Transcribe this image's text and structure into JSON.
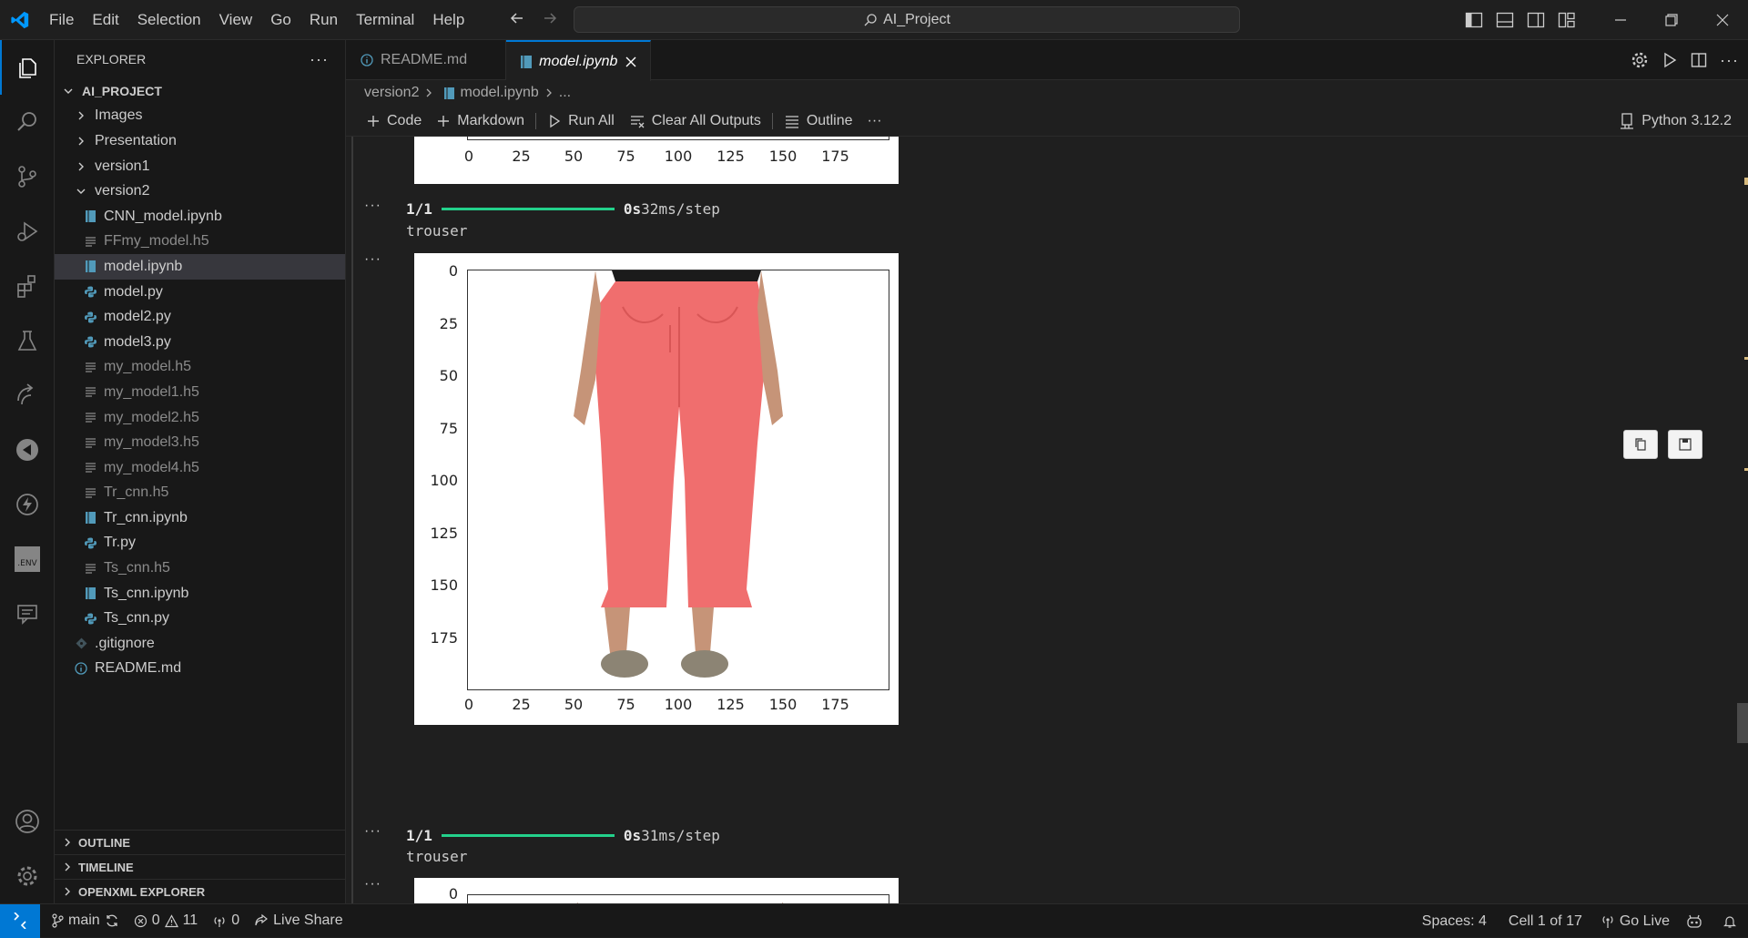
{
  "titlebar": {
    "menu": [
      "File",
      "Edit",
      "Selection",
      "View",
      "Go",
      "Run",
      "Terminal",
      "Help"
    ],
    "search_text": "AI_Project"
  },
  "sidebar": {
    "title": "EXPLORER",
    "project": "AI_PROJECT",
    "items": [
      {
        "label": "Images",
        "type": "folder",
        "state": "closed",
        "depth": 1
      },
      {
        "label": "Presentation",
        "type": "folder",
        "state": "closed",
        "depth": 1
      },
      {
        "label": "version1",
        "type": "folder",
        "state": "closed",
        "depth": 1
      },
      {
        "label": "version2",
        "type": "folder",
        "state": "open",
        "depth": 1
      },
      {
        "label": "CNN_model.ipynb",
        "type": "notebook",
        "depth": 2
      },
      {
        "label": "FFmy_model.h5",
        "type": "h5",
        "depth": 2
      },
      {
        "label": "model.ipynb",
        "type": "notebook",
        "depth": 2,
        "selected": true
      },
      {
        "label": "model.py",
        "type": "python",
        "depth": 2
      },
      {
        "label": "model2.py",
        "type": "python",
        "depth": 2
      },
      {
        "label": "model3.py",
        "type": "python",
        "depth": 2
      },
      {
        "label": "my_model.h5",
        "type": "h5",
        "depth": 2
      },
      {
        "label": "my_model1.h5",
        "type": "h5",
        "depth": 2
      },
      {
        "label": "my_model2.h5",
        "type": "h5",
        "depth": 2
      },
      {
        "label": "my_model3.h5",
        "type": "h5",
        "depth": 2
      },
      {
        "label": "my_model4.h5",
        "type": "h5",
        "depth": 2
      },
      {
        "label": "Tr_cnn.h5",
        "type": "h5",
        "depth": 2
      },
      {
        "label": "Tr_cnn.ipynb",
        "type": "notebook",
        "depth": 2
      },
      {
        "label": "Tr.py",
        "type": "python",
        "depth": 2
      },
      {
        "label": "Ts_cnn.h5",
        "type": "h5",
        "depth": 2
      },
      {
        "label": "Ts_cnn.ipynb",
        "type": "notebook",
        "depth": 2
      },
      {
        "label": "Ts_cnn.py",
        "type": "python",
        "depth": 2
      },
      {
        "label": ".gitignore",
        "type": "git",
        "depth": 1
      },
      {
        "label": "README.md",
        "type": "info",
        "depth": 1
      }
    ],
    "panels": [
      "OUTLINE",
      "TIMELINE",
      "OPENXML EXPLORER"
    ]
  },
  "tabs": [
    {
      "label": "README.md",
      "active": false
    },
    {
      "label": "model.ipynb",
      "active": true
    }
  ],
  "breadcrumb": [
    "version2",
    "model.ipynb",
    "..."
  ],
  "toolbar": {
    "code": "Code",
    "markdown": "Markdown",
    "run_all": "Run All",
    "clear": "Clear All Outputs",
    "outline": "Outline",
    "more": "···",
    "kernel": "Python 3.12.2"
  },
  "outputs": {
    "dots": "···",
    "x_ticks": [
      "0",
      "25",
      "50",
      "75",
      "100",
      "125",
      "150",
      "175"
    ],
    "y_ticks": [
      "0",
      "25",
      "50",
      "75",
      "100",
      "125",
      "150",
      "175"
    ],
    "y_ticks_partial": [
      "0"
    ],
    "progress": [
      {
        "step": "1/1",
        "time": "0s",
        "rate": "32ms/step",
        "label": "trouser"
      },
      {
        "step": "1/1",
        "time": "0s",
        "rate": "31ms/step",
        "label": "trouser"
      }
    ]
  },
  "statusbar": {
    "branch": "main",
    "errors": "0",
    "warnings": "11",
    "ports": "0",
    "live_share": "Live Share",
    "spaces": "Spaces: 4",
    "cell": "Cell 1 of 17",
    "go_live": "Go Live"
  },
  "colors": {
    "accent": "#0078d4",
    "progress": "#23d18b",
    "notebook_icon": "#519aba",
    "python_icon": "#519aba"
  }
}
